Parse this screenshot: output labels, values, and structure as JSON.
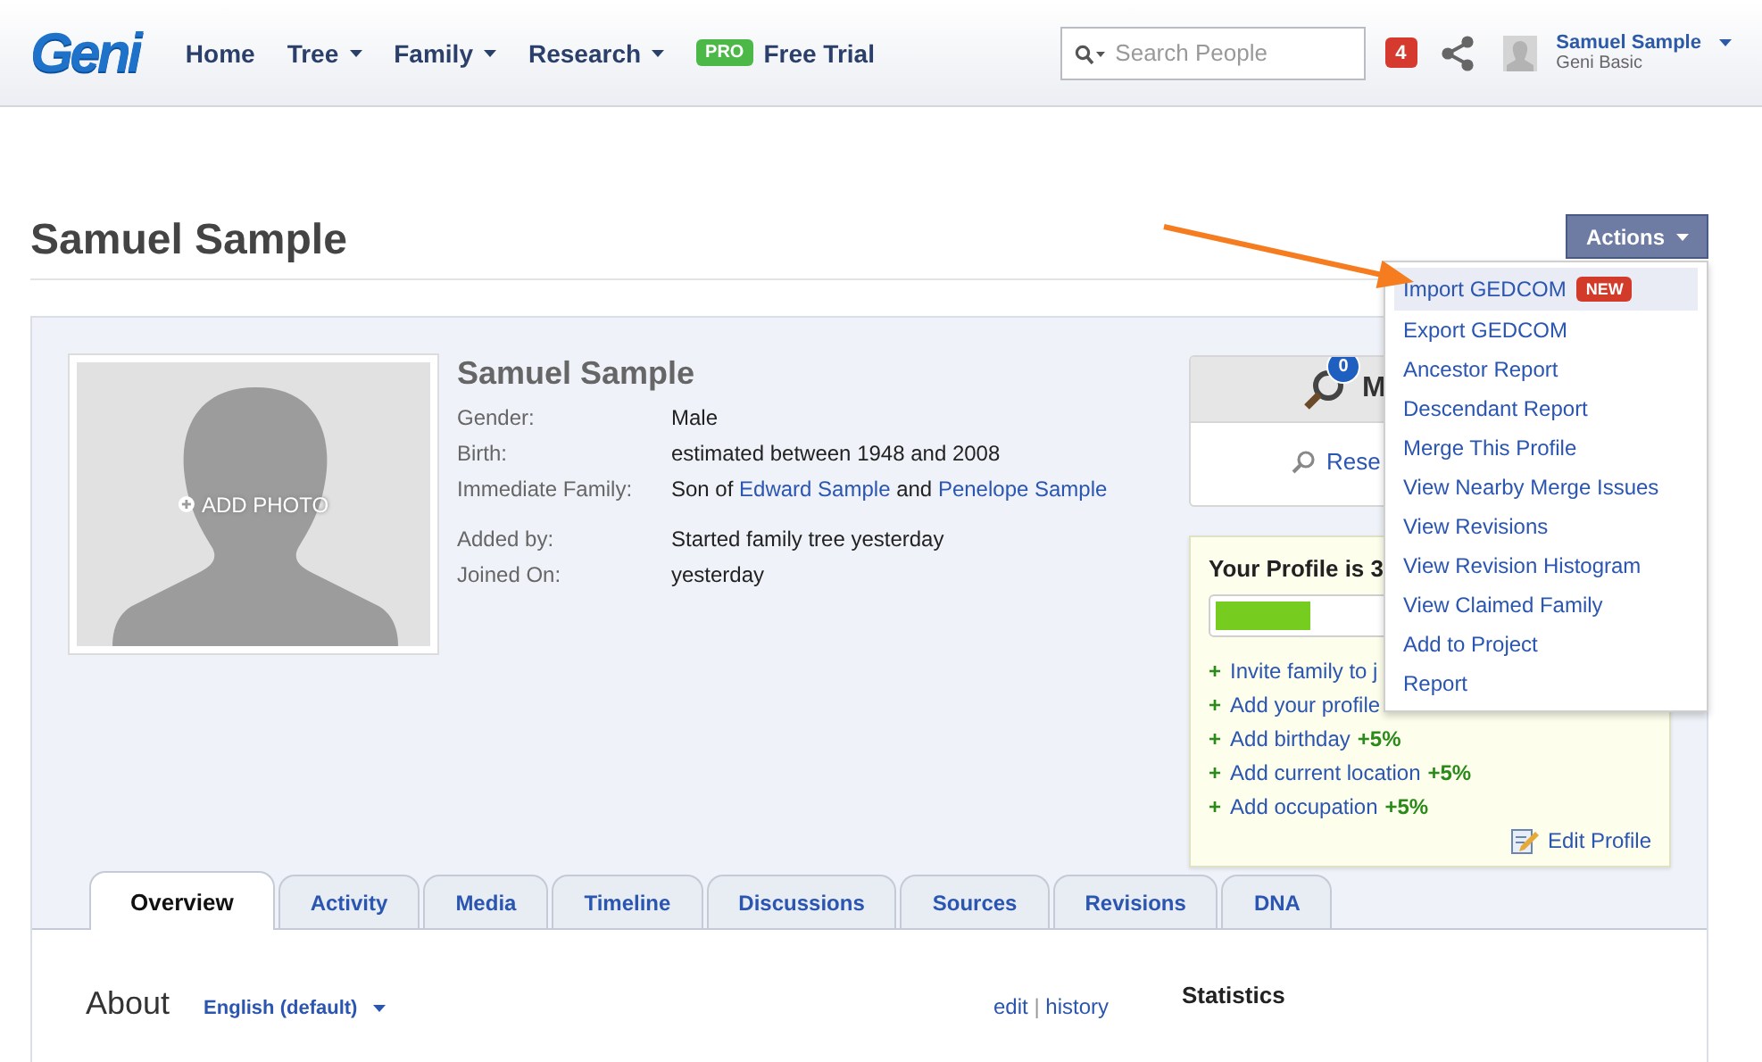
{
  "header": {
    "logo": "Geni",
    "nav": [
      {
        "label": "Home",
        "dropdown": false
      },
      {
        "label": "Tree",
        "dropdown": true
      },
      {
        "label": "Family",
        "dropdown": true
      },
      {
        "label": "Research",
        "dropdown": true
      }
    ],
    "pro_badge": "PRO",
    "trial": "Free Trial",
    "search": {
      "placeholder": "Search People"
    },
    "notifications": "4",
    "user": {
      "name": "Samuel Sample",
      "plan": "Geni Basic"
    }
  },
  "page_title": "Samuel Sample",
  "actions": {
    "label": "Actions",
    "expanded": true,
    "items": [
      {
        "label": "Import GEDCOM",
        "badge": "NEW",
        "selected": true
      },
      {
        "label": "Export GEDCOM",
        "selected": false
      },
      {
        "label": "Ancestor Report",
        "selected": false
      },
      {
        "label": "Descendant Report",
        "selected": false
      },
      {
        "label": "Merge This Profile",
        "selected": false
      },
      {
        "label": "View Nearby Merge Issues",
        "selected": false
      },
      {
        "label": "View Revisions",
        "selected": false
      },
      {
        "label": "View Revision Histogram",
        "selected": false
      },
      {
        "label": "View Claimed Family",
        "selected": false
      },
      {
        "label": "Add to Project",
        "selected": false
      },
      {
        "label": "Report",
        "selected": false
      }
    ]
  },
  "profile": {
    "name": "Samuel Sample",
    "photo_label": "ADD PHOTO",
    "facts": [
      {
        "label": "Gender:",
        "parts": [
          {
            "text": "Male",
            "link": false
          }
        ]
      },
      {
        "label": "Birth:",
        "parts": [
          {
            "text": "estimated between 1948 and 2008",
            "link": false
          }
        ]
      },
      {
        "label": "Immediate Family:",
        "parts": [
          {
            "text": "Son of ",
            "link": false
          },
          {
            "text": "Edward Sample",
            "link": true
          },
          {
            "text": " and ",
            "link": false
          },
          {
            "text": "Penelope Sample",
            "link": true
          }
        ]
      }
    ],
    "account_facts": [
      {
        "label": "Added by:",
        "parts": [
          {
            "text": "Started family tree yesterday",
            "link": false
          }
        ]
      },
      {
        "label": "Joined On:",
        "parts": [
          {
            "text": "yesterday",
            "link": false
          }
        ]
      }
    ]
  },
  "matches": {
    "count": "0",
    "title": "M",
    "research": "Rese"
  },
  "completion": {
    "title": "Your Profile is 3",
    "level": 0.22,
    "tasks": [
      {
        "sign": "+",
        "label": "Invite family to j"
      },
      {
        "sign": "+",
        "label": "Add your profile"
      },
      {
        "sign": "+",
        "label": "Add birthday",
        "bonus": "+5%"
      },
      {
        "sign": "+",
        "label": "Add current location",
        "bonus": "+5%"
      },
      {
        "sign": "+",
        "label": "Add occupation",
        "bonus": "+5%"
      }
    ],
    "edit": "Edit Profile"
  },
  "tabs": [
    {
      "label": "Overview",
      "selected": true
    },
    {
      "label": "Activity",
      "selected": false
    },
    {
      "label": "Media",
      "selected": false
    },
    {
      "label": "Timeline",
      "selected": false
    },
    {
      "label": "Discussions",
      "selected": false
    },
    {
      "label": "Sources",
      "selected": false
    },
    {
      "label": "Revisions",
      "selected": false
    },
    {
      "label": "DNA",
      "selected": false
    }
  ],
  "about": {
    "title": "About",
    "language": "English (default)",
    "edit": "edit",
    "separator": "|",
    "history": "history"
  },
  "statistics": {
    "title": "Statistics"
  }
}
